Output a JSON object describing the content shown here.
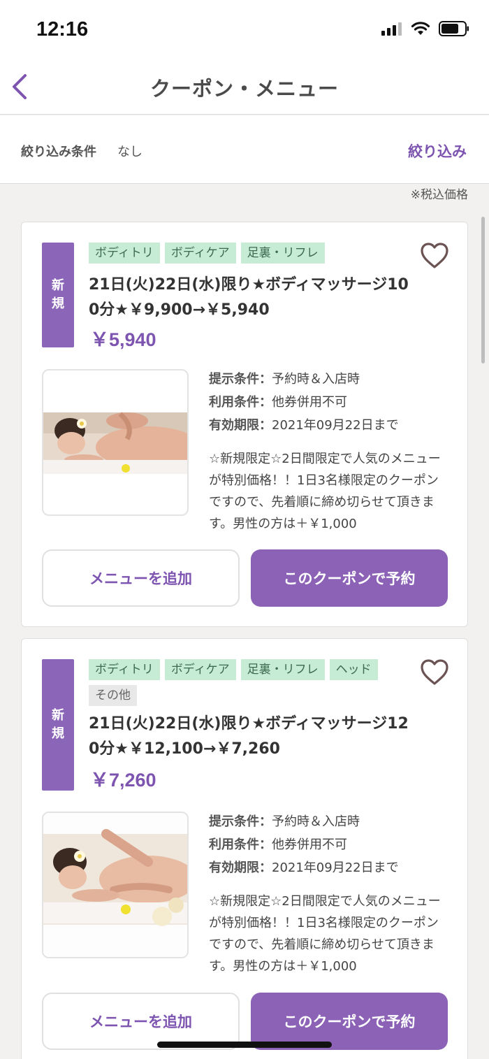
{
  "status_bar": {
    "time": "12:16"
  },
  "nav": {
    "title": "クーポン・メニュー"
  },
  "filter": {
    "label": "絞り込み条件",
    "value": "なし",
    "action": "絞り込み"
  },
  "tax_note": "※税込価格",
  "coupons": [
    {
      "badge": "新規",
      "tags": [
        "ボディトリ",
        "ボディケア",
        "足裏・リフレ"
      ],
      "title": "21日(火)22日(水)限り★ボディマッサージ100分★￥9,900→￥5,940",
      "price": "￥5,940",
      "conditions": [
        {
          "key": "提示条件",
          "value": "予約時＆入店時"
        },
        {
          "key": "利用条件",
          "value": "他券併用不可"
        },
        {
          "key": "有効期限",
          "value": "2021年09月22日まで"
        }
      ],
      "description": "☆新規限定☆2日間限定で人気のメニューが特別価格！！1日3名様限定のクーポンですので、先着順に締め切らせて頂きます。男性の方は＋￥1,000",
      "add_button": "メニューを追加",
      "reserve_button": "このクーポンで予約"
    },
    {
      "badge": "新規",
      "tags": [
        "ボディトリ",
        "ボディケア",
        "足裏・リフレ",
        "ヘッド",
        "その他"
      ],
      "title": "21日(火)22日(水)限り★ボディマッサージ120分★￥12,100→￥7,260",
      "price": "￥7,260",
      "conditions": [
        {
          "key": "提示条件",
          "value": "予約時＆入店時"
        },
        {
          "key": "利用条件",
          "value": "他券併用不可"
        },
        {
          "key": "有効期限",
          "value": "2021年09月22日まで"
        }
      ],
      "description": "☆新規限定☆2日間限定で人気のメニューが特別価格！！1日3名様限定のクーポンですので、先着順に締め切らせて頂きます。男性の方は＋￥1,000",
      "add_button": "メニューを追加",
      "reserve_button": "このクーポンで予約"
    }
  ],
  "colors": {
    "accent": "#7d55b0",
    "badge": "#8b66b8",
    "tag_bg": "#c7ecd6",
    "tag_gray_bg": "#e8e8e8"
  }
}
